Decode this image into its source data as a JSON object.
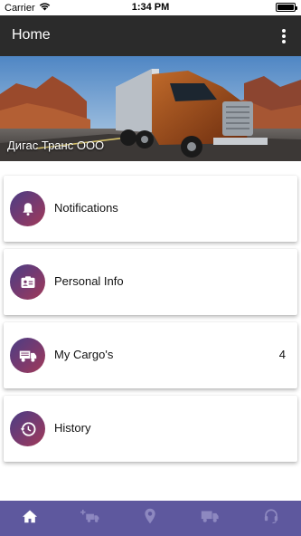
{
  "status_bar": {
    "carrier": "Carrier",
    "time": "1:34 PM",
    "battery_level": 1.0
  },
  "app_bar": {
    "title": "Home",
    "menu_icon": "more-vertical-icon"
  },
  "hero": {
    "caption": "Дигас Транс ООО"
  },
  "menu": [
    {
      "label": "Notifications",
      "icon": "bell-icon",
      "count": ""
    },
    {
      "label": "Personal Info",
      "icon": "id-card-icon",
      "count": ""
    },
    {
      "label": "My Cargo's",
      "icon": "truck-icon",
      "count": "4"
    },
    {
      "label": "History",
      "icon": "history-icon",
      "count": ""
    }
  ],
  "bottom_nav": [
    {
      "icon": "home-icon",
      "active": true
    },
    {
      "icon": "add-cargo-icon",
      "active": false
    },
    {
      "icon": "location-icon",
      "active": false
    },
    {
      "icon": "truck-icon",
      "active": false
    },
    {
      "icon": "support-headset-icon",
      "active": false
    }
  ],
  "colors": {
    "app_bar": "#2b2b2b",
    "bottom_nav": "#5e589e",
    "icon_gradient_start": "#4a3d85",
    "icon_gradient_end": "#a13a58"
  }
}
